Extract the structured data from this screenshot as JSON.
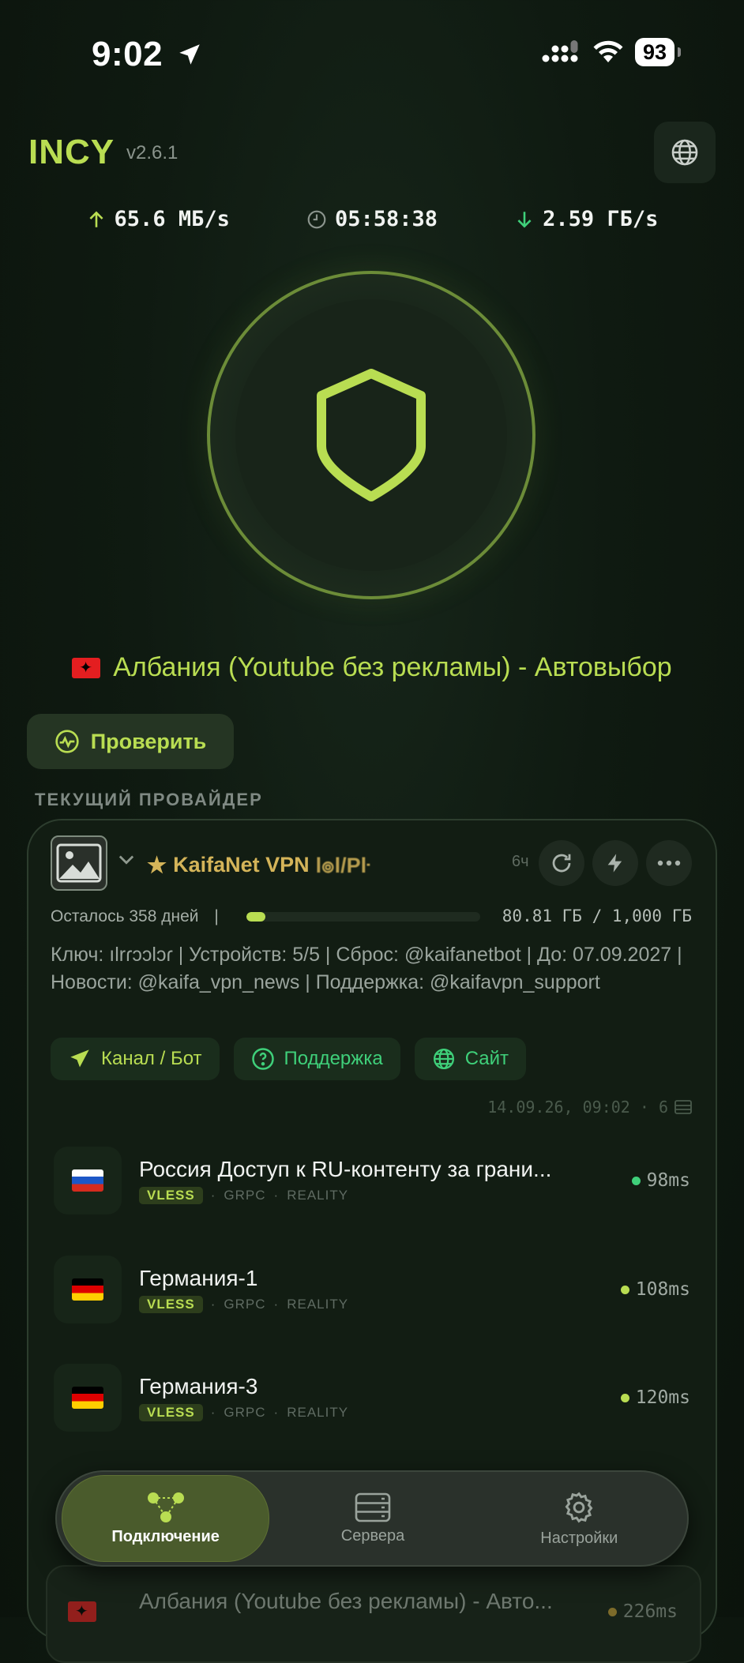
{
  "status_bar": {
    "time": "9:02",
    "battery": "93"
  },
  "header": {
    "brand": "INCY",
    "version": "v2.6.1"
  },
  "stats": {
    "upload": "65.6 МБ/s",
    "session_time": "05:58:38",
    "download": "2.59 ГБ/s"
  },
  "connection": {
    "server_title": "Албания (Youtube без рекламы) - Автовыбор",
    "check_label": "Проверить"
  },
  "provider_section_label": "ТЕКУЩИЙ ПРОВАЙДЕР",
  "provider": {
    "name": "KaifaNet VPN",
    "name_suffix": "l๏l/Pŀ",
    "age": "6ч",
    "days_left": "Осталось 358 дней",
    "separator": "|",
    "usage_fraction": 0.08,
    "traffic": "80.81 ГБ / 1,000 ГБ",
    "description": "Ключ: ılrɾᴐɔlᴐɾ | Устройств: 5/5 | Сброс: @kaifanetbot | До: 07.09.2027 | Новости: @kaifa_vpn_news | Поддержка: @kaifavpn_support",
    "links": [
      {
        "label": "Канал / Бот",
        "color": "#b9dd52"
      },
      {
        "label": "Поддержка",
        "color": "#3fd07a"
      },
      {
        "label": "Сайт",
        "color": "#3fd07a"
      }
    ],
    "updated": "14.09.26, 09:02 · 6"
  },
  "servers": [
    {
      "flag": "ru",
      "name": "Россия Доступ к RU-контенту за грани...",
      "protocol": "VLESS",
      "transport": "GRPC",
      "security": "REALITY",
      "ping": "98ms",
      "dot_color": "#3fd07a"
    },
    {
      "flag": "de",
      "name": "Германия-1",
      "protocol": "VLESS",
      "transport": "GRPC",
      "security": "REALITY",
      "ping": "108ms",
      "dot_color": "#b9dd52"
    },
    {
      "flag": "de",
      "name": "Германия-3",
      "protocol": "VLESS",
      "transport": "GRPC",
      "security": "REALITY",
      "ping": "120ms",
      "dot_color": "#b9dd52"
    }
  ],
  "peek_server": {
    "name": "Албания (Youtube без рекламы) - Авто...",
    "ping": "226ms"
  },
  "nav": {
    "connection": "Подключение",
    "servers": "Сервера",
    "settings": "Настройки"
  },
  "colors": {
    "accent": "#b9dd52",
    "provider_gold": "#d4b459",
    "ok_green": "#3fd07a"
  }
}
